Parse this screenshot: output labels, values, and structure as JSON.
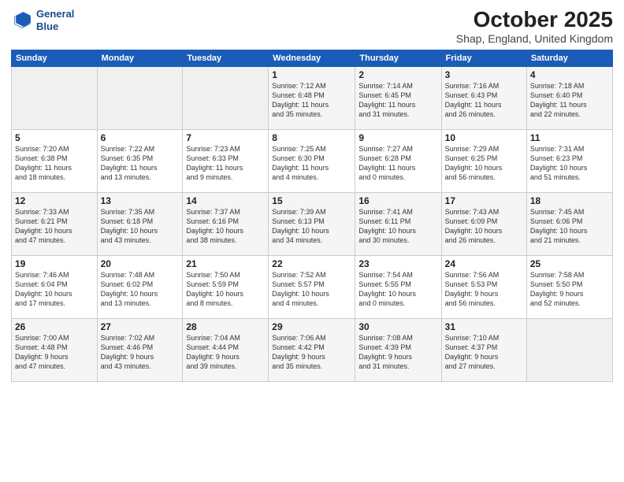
{
  "header": {
    "logo_line1": "General",
    "logo_line2": "Blue",
    "month": "October 2025",
    "location": "Shap, England, United Kingdom"
  },
  "weekdays": [
    "Sunday",
    "Monday",
    "Tuesday",
    "Wednesday",
    "Thursday",
    "Friday",
    "Saturday"
  ],
  "weeks": [
    [
      {
        "day": "",
        "info": ""
      },
      {
        "day": "",
        "info": ""
      },
      {
        "day": "",
        "info": ""
      },
      {
        "day": "1",
        "info": "Sunrise: 7:12 AM\nSunset: 6:48 PM\nDaylight: 11 hours\nand 35 minutes."
      },
      {
        "day": "2",
        "info": "Sunrise: 7:14 AM\nSunset: 6:45 PM\nDaylight: 11 hours\nand 31 minutes."
      },
      {
        "day": "3",
        "info": "Sunrise: 7:16 AM\nSunset: 6:43 PM\nDaylight: 11 hours\nand 26 minutes."
      },
      {
        "day": "4",
        "info": "Sunrise: 7:18 AM\nSunset: 6:40 PM\nDaylight: 11 hours\nand 22 minutes."
      }
    ],
    [
      {
        "day": "5",
        "info": "Sunrise: 7:20 AM\nSunset: 6:38 PM\nDaylight: 11 hours\nand 18 minutes."
      },
      {
        "day": "6",
        "info": "Sunrise: 7:22 AM\nSunset: 6:35 PM\nDaylight: 11 hours\nand 13 minutes."
      },
      {
        "day": "7",
        "info": "Sunrise: 7:23 AM\nSunset: 6:33 PM\nDaylight: 11 hours\nand 9 minutes."
      },
      {
        "day": "8",
        "info": "Sunrise: 7:25 AM\nSunset: 6:30 PM\nDaylight: 11 hours\nand 4 minutes."
      },
      {
        "day": "9",
        "info": "Sunrise: 7:27 AM\nSunset: 6:28 PM\nDaylight: 11 hours\nand 0 minutes."
      },
      {
        "day": "10",
        "info": "Sunrise: 7:29 AM\nSunset: 6:25 PM\nDaylight: 10 hours\nand 56 minutes."
      },
      {
        "day": "11",
        "info": "Sunrise: 7:31 AM\nSunset: 6:23 PM\nDaylight: 10 hours\nand 51 minutes."
      }
    ],
    [
      {
        "day": "12",
        "info": "Sunrise: 7:33 AM\nSunset: 6:21 PM\nDaylight: 10 hours\nand 47 minutes."
      },
      {
        "day": "13",
        "info": "Sunrise: 7:35 AM\nSunset: 6:18 PM\nDaylight: 10 hours\nand 43 minutes."
      },
      {
        "day": "14",
        "info": "Sunrise: 7:37 AM\nSunset: 6:16 PM\nDaylight: 10 hours\nand 38 minutes."
      },
      {
        "day": "15",
        "info": "Sunrise: 7:39 AM\nSunset: 6:13 PM\nDaylight: 10 hours\nand 34 minutes."
      },
      {
        "day": "16",
        "info": "Sunrise: 7:41 AM\nSunset: 6:11 PM\nDaylight: 10 hours\nand 30 minutes."
      },
      {
        "day": "17",
        "info": "Sunrise: 7:43 AM\nSunset: 6:09 PM\nDaylight: 10 hours\nand 26 minutes."
      },
      {
        "day": "18",
        "info": "Sunrise: 7:45 AM\nSunset: 6:06 PM\nDaylight: 10 hours\nand 21 minutes."
      }
    ],
    [
      {
        "day": "19",
        "info": "Sunrise: 7:46 AM\nSunset: 6:04 PM\nDaylight: 10 hours\nand 17 minutes."
      },
      {
        "day": "20",
        "info": "Sunrise: 7:48 AM\nSunset: 6:02 PM\nDaylight: 10 hours\nand 13 minutes."
      },
      {
        "day": "21",
        "info": "Sunrise: 7:50 AM\nSunset: 5:59 PM\nDaylight: 10 hours\nand 8 minutes."
      },
      {
        "day": "22",
        "info": "Sunrise: 7:52 AM\nSunset: 5:57 PM\nDaylight: 10 hours\nand 4 minutes."
      },
      {
        "day": "23",
        "info": "Sunrise: 7:54 AM\nSunset: 5:55 PM\nDaylight: 10 hours\nand 0 minutes."
      },
      {
        "day": "24",
        "info": "Sunrise: 7:56 AM\nSunset: 5:53 PM\nDaylight: 9 hours\nand 56 minutes."
      },
      {
        "day": "25",
        "info": "Sunrise: 7:58 AM\nSunset: 5:50 PM\nDaylight: 9 hours\nand 52 minutes."
      }
    ],
    [
      {
        "day": "26",
        "info": "Sunrise: 7:00 AM\nSunset: 4:48 PM\nDaylight: 9 hours\nand 47 minutes."
      },
      {
        "day": "27",
        "info": "Sunrise: 7:02 AM\nSunset: 4:46 PM\nDaylight: 9 hours\nand 43 minutes."
      },
      {
        "day": "28",
        "info": "Sunrise: 7:04 AM\nSunset: 4:44 PM\nDaylight: 9 hours\nand 39 minutes."
      },
      {
        "day": "29",
        "info": "Sunrise: 7:06 AM\nSunset: 4:42 PM\nDaylight: 9 hours\nand 35 minutes."
      },
      {
        "day": "30",
        "info": "Sunrise: 7:08 AM\nSunset: 4:39 PM\nDaylight: 9 hours\nand 31 minutes."
      },
      {
        "day": "31",
        "info": "Sunrise: 7:10 AM\nSunset: 4:37 PM\nDaylight: 9 hours\nand 27 minutes."
      },
      {
        "day": "",
        "info": ""
      }
    ]
  ]
}
